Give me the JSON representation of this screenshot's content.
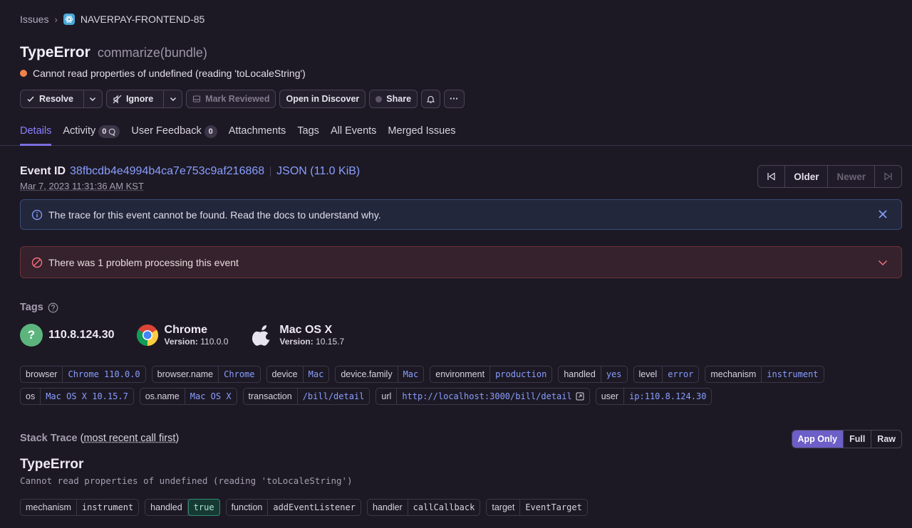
{
  "breadcrumb": {
    "issues": "Issues",
    "separator": "›",
    "project": "NAVERPAY-FRONTEND-85"
  },
  "issue": {
    "type": "TypeError",
    "culprit": "commarize(bundle)",
    "message": "Cannot read properties of undefined (reading 'toLocaleString')",
    "level_color": "#f0824a"
  },
  "actions": {
    "resolve": "Resolve",
    "ignore": "Ignore",
    "mark_reviewed": "Mark Reviewed",
    "open_discover": "Open in Discover",
    "share": "Share",
    "more": "···"
  },
  "tabs": [
    {
      "label": "Details"
    },
    {
      "label": "Activity",
      "count": "0"
    },
    {
      "label": "User Feedback",
      "count": "0"
    },
    {
      "label": "Attachments"
    },
    {
      "label": "Tags"
    },
    {
      "label": "All Events"
    },
    {
      "label": "Merged Issues"
    }
  ],
  "event": {
    "id_label": "Event ID",
    "id": "38fbcdb4e4994b4ca7e753c9af216868",
    "json": "JSON (11.0 KiB)",
    "date": "Mar 7, 2023 11:31:36 AM KST"
  },
  "nav": {
    "older": "Older",
    "newer": "Newer"
  },
  "alerts": {
    "info": "The trace for this event cannot be found. Read the docs to understand why.",
    "error": "There was 1 problem processing this event"
  },
  "tags_section": {
    "title": "Tags",
    "summary": {
      "ip": "110.8.124.30",
      "browser_name": "Chrome",
      "browser_version_label": "Version:",
      "browser_version": "110.0.0",
      "os_name": "Mac OS X",
      "os_version_label": "Version:",
      "os_version": "10.15.7"
    },
    "row1": [
      {
        "k": "browser",
        "v": "Chrome 110.0.0"
      },
      {
        "k": "browser.name",
        "v": "Chrome"
      },
      {
        "k": "device",
        "v": "Mac"
      },
      {
        "k": "device.family",
        "v": "Mac"
      },
      {
        "k": "environment",
        "v": "production"
      },
      {
        "k": "handled",
        "v": "yes"
      },
      {
        "k": "level",
        "v": "error"
      },
      {
        "k": "mechanism",
        "v": "instrument"
      }
    ],
    "row2": [
      {
        "k": "os",
        "v": "Mac OS X 10.15.7"
      },
      {
        "k": "os.name",
        "v": "Mac OS X"
      },
      {
        "k": "transaction",
        "v": "/bill/detail"
      },
      {
        "k": "url",
        "v": "http://localhost:3000/bill/detail"
      },
      {
        "k": "user",
        "v": "ip:110.8.124.30"
      }
    ]
  },
  "stack": {
    "title": "Stack Trace",
    "order_link": "most recent call first",
    "modes": [
      "App Only",
      "Full",
      "Raw"
    ],
    "exception_type": "TypeError",
    "exception_message": "Cannot read properties of undefined (reading 'toLocaleString')",
    "mechanism": [
      {
        "k": "mechanism",
        "v": "instrument"
      },
      {
        "k": "handled",
        "v": "true"
      },
      {
        "k": "function",
        "v": "addEventListener"
      },
      {
        "k": "handler",
        "v": "callCallback"
      },
      {
        "k": "target",
        "v": "EventTarget"
      }
    ]
  }
}
